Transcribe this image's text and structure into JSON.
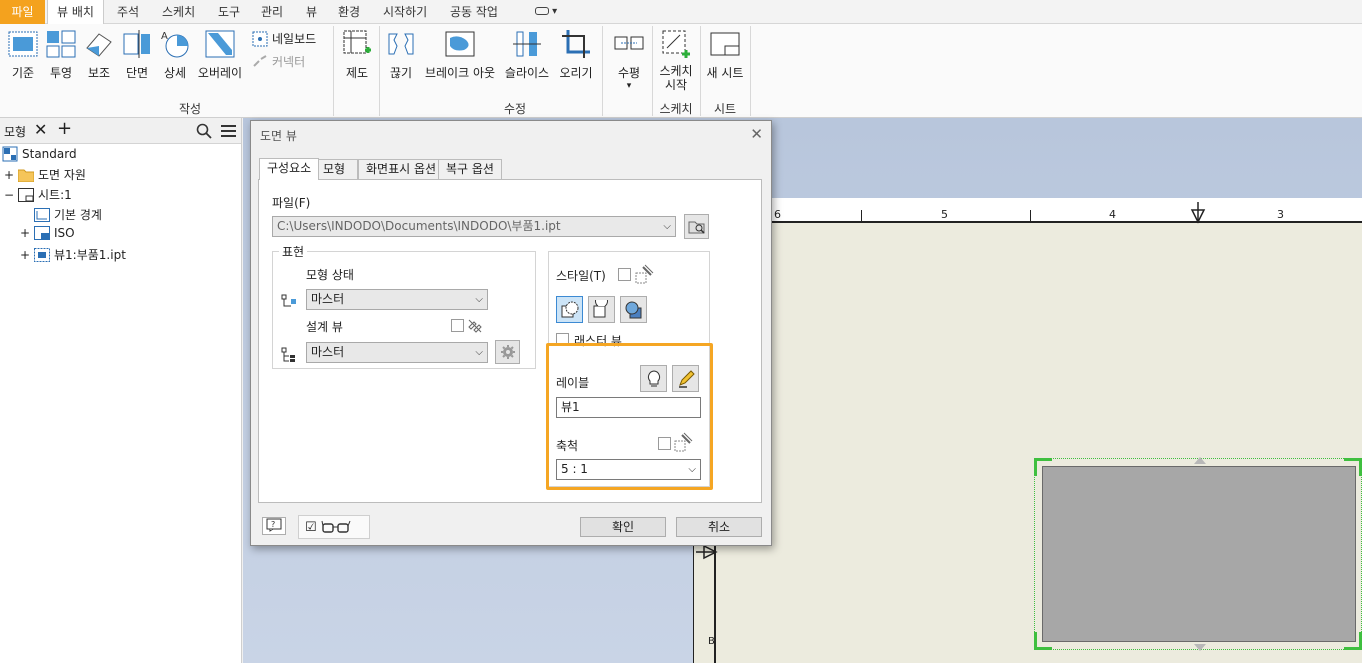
{
  "ribbon_tabs": [
    "파일",
    "뷰 배치",
    "주석",
    "스케치",
    "도구",
    "관리",
    "뷰",
    "환경",
    "시작하기",
    "공동 작업"
  ],
  "ribbon": {
    "create": [
      "기준",
      "투영",
      "보조",
      "단면",
      "상세",
      "오버레이"
    ],
    "create_small": [
      "네일보드",
      "커넥터"
    ],
    "create_group": "작성",
    "make": "제도",
    "modify": [
      "끊기",
      "브레이크 아웃",
      "슬라이스",
      "오리기"
    ],
    "modify_group": "수정",
    "horizontal": "수평",
    "sketch_start": [
      "스케치",
      "시작"
    ],
    "sketch_group": "스케치",
    "new_sheet": "새 시트",
    "sheet_group": "시트"
  },
  "browser": {
    "tab": "모형",
    "items": [
      {
        "label": "Standard",
        "indent": 0,
        "expander": ""
      },
      {
        "label": "도면 자원",
        "indent": 1,
        "expander": "+"
      },
      {
        "label": "시트:1",
        "indent": 1,
        "expander": "−"
      },
      {
        "label": "기본 경계",
        "indent": 2,
        "expander": ""
      },
      {
        "label": "ISO",
        "indent": 2,
        "expander": "+"
      },
      {
        "label": "뷰1:부품1.ipt",
        "indent": 2,
        "expander": "+"
      }
    ]
  },
  "sheet": {
    "ruler_numbers": [
      "6",
      "5",
      "4",
      "3"
    ],
    "zone_letter": "B"
  },
  "dialog": {
    "title": "도면 뷰",
    "tabs": [
      "구성요소",
      "모형",
      "화면표시 옵션",
      "복구 옵션"
    ],
    "file_label": "파일(F)",
    "file_path": "C:\\Users\\INDODO\\Documents\\INDODO\\부품1.ipt",
    "representation_label": "표현",
    "model_state_label": "모형 상태",
    "model_state_value": "마스터",
    "design_view_label": "설계 뷰",
    "design_view_value": "마스터",
    "style_label": "스타일(T)",
    "raster_view_label": "래스터 뷰",
    "label_label": "레이블",
    "label_value": "뷰1",
    "scale_label": "축척",
    "scale_value": "5 : 1",
    "ok": "확인",
    "cancel": "취소"
  },
  "colors": {
    "file_tab": "#f4a21e",
    "highlight": "#f5a623",
    "selection_green": "#3fbf3f",
    "view_fill": "#a7a7a7",
    "sheet": "#ecebde"
  }
}
